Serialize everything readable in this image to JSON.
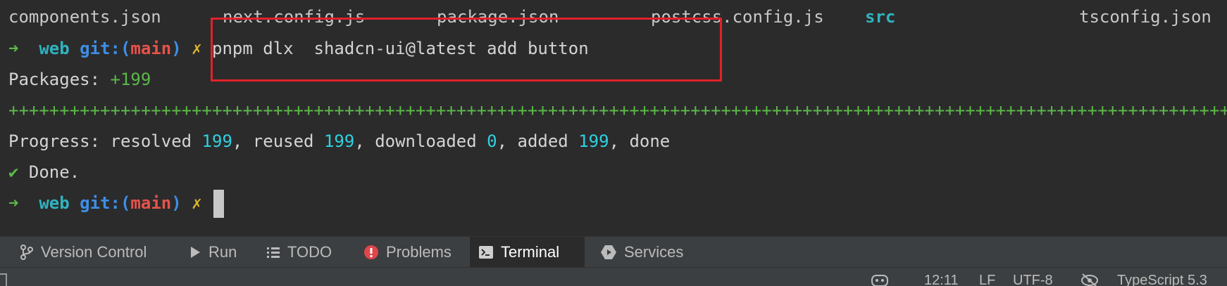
{
  "terminal": {
    "files": [
      "components.json",
      "next.config.js",
      "package.json",
      "postcss.config.js",
      "src",
      "tsconfig.json"
    ],
    "prompt": {
      "arrow": "➜",
      "dir": "web",
      "git_label": "git:(",
      "branch": "main",
      "git_close": ")",
      "dirty_mark": "✗"
    },
    "command": "pnpm dlx  shadcn-ui@latest add button",
    "packages_label": "Packages: ",
    "packages_count": "+199",
    "progress_bar": "++++++++++++++++++++++++++++++++++++++++++++++++++++++++++++++++++++++++++++++++++++++++++++++++++++++++++++++++++++++++++++++++++++++++++++++++++++++++++++++++++++++++++++++++++++++++++++++++++++++++",
    "progress": {
      "label": "Progress: resolved ",
      "resolved": "199",
      "reused_label": ", reused ",
      "reused": "199",
      "downloaded_label": ", downloaded ",
      "downloaded": "0",
      "added_label": ", added ",
      "added": "199",
      "done_label": ", done"
    },
    "done": {
      "check": "✔",
      "text": " Done."
    }
  },
  "tool_windows": {
    "version_control": "Version Control",
    "run": "Run",
    "todo": "TODO",
    "problems": "Problems",
    "terminal": "Terminal",
    "services": "Services"
  },
  "status_bar": {
    "position": "12:11",
    "line_ending": "LF",
    "encoding": "UTF-8",
    "language": "TypeScript 5.3"
  },
  "colors": {
    "background": "#2b2b2b",
    "highlight_box": "#e0222a",
    "prompt_arrow": "#5bb848",
    "branch": "#e5534b",
    "numbers": "#2fd0e0"
  }
}
